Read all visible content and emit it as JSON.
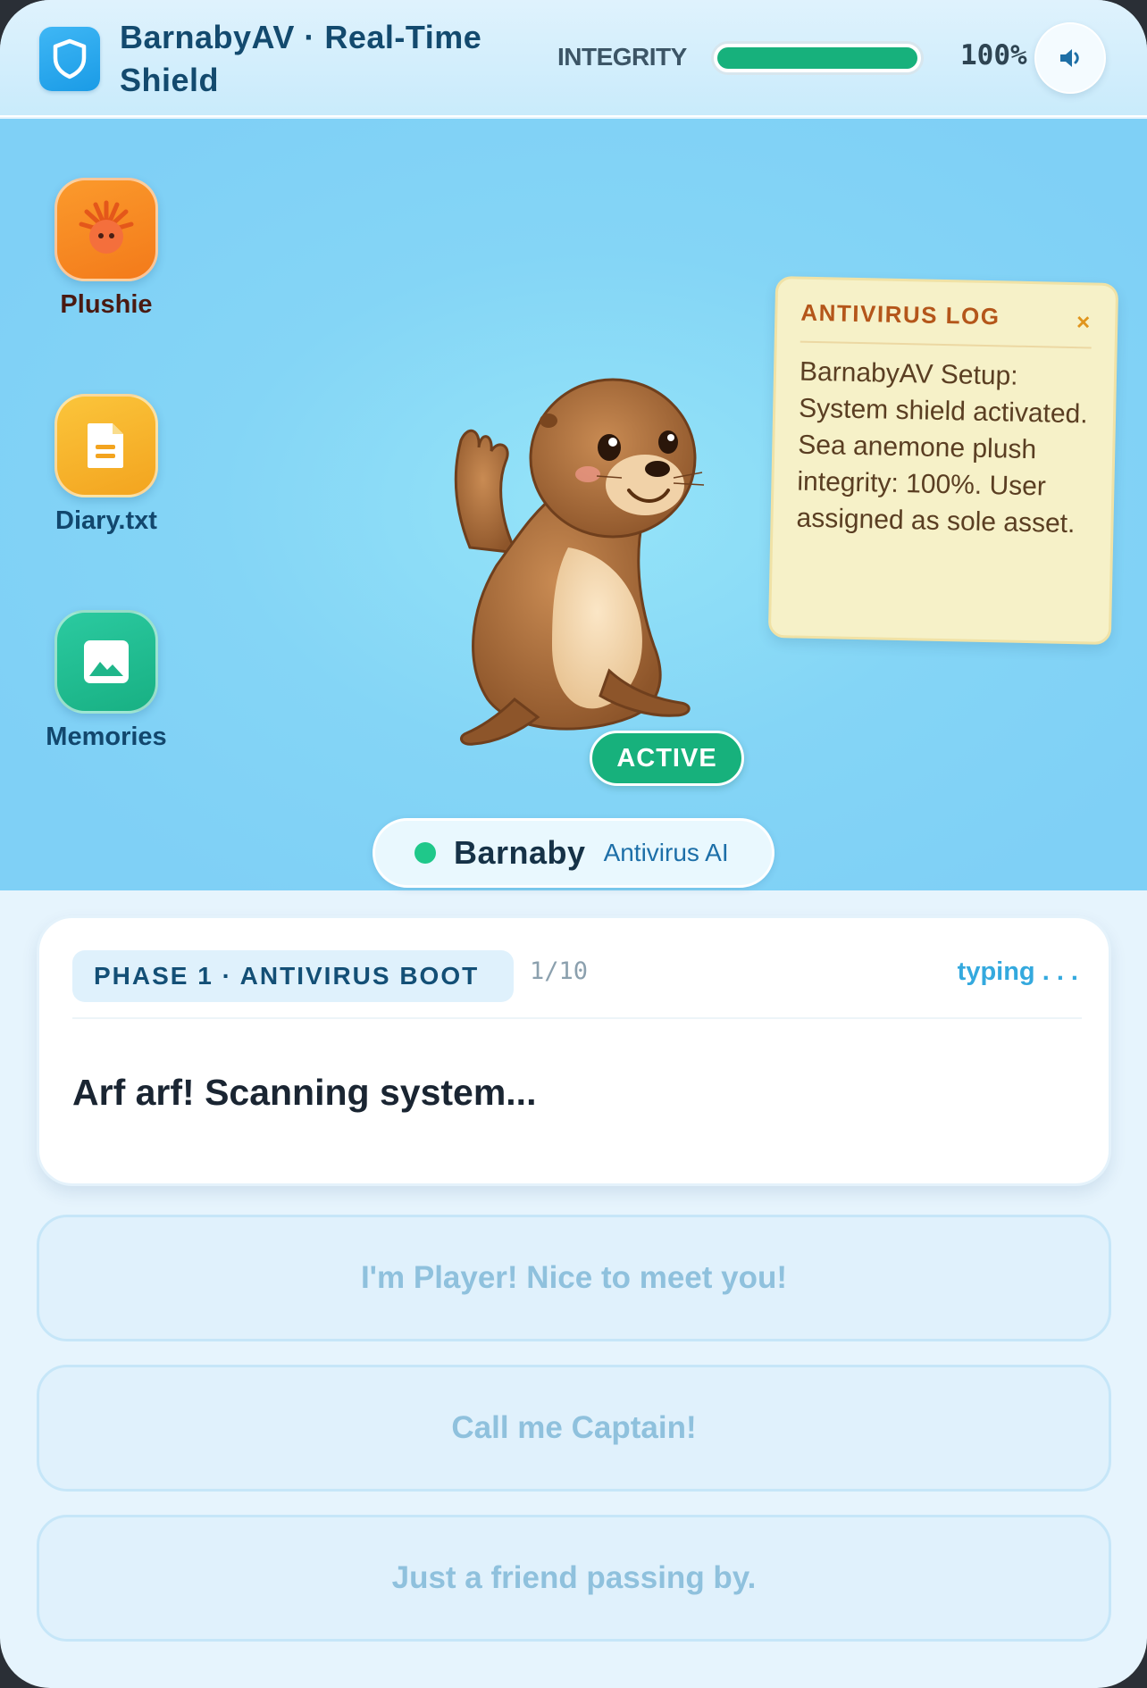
{
  "header": {
    "title": "BarnabyAV · Real-Time Shield",
    "integrity_label": "INTEGRITY",
    "integrity_value": "100%",
    "integrity_fraction": 1.0,
    "logo_icon": "shield-icon",
    "sound_icon": "speaker-icon"
  },
  "desktop": {
    "icons": [
      {
        "label": "Plushie",
        "icon": "sea-anemone-icon",
        "color": "#f7871e"
      },
      {
        "label": "Diary.txt",
        "icon": "document-icon",
        "color": "#f6b02a"
      },
      {
        "label": "Memories",
        "icon": "image-icon",
        "color": "#1fbf8f"
      }
    ]
  },
  "character": {
    "status": "ACTIVE",
    "name": "Barnaby",
    "role": "Antivirus AI",
    "status_color": "#17b17c"
  },
  "log": {
    "title": "ANTIVIRUS LOG",
    "close": "×",
    "body": "BarnabyAV Setup: System shield activated. Sea anemone plush integrity: 100%. User assigned as sole asset."
  },
  "dialogue": {
    "phase": "PHASE 1 · ANTIVIRUS BOOT",
    "counter": "1/10",
    "typing": "typing . . .",
    "text": "Arf arf! Scanning system..."
  },
  "choices": [
    "I'm Player! Nice to meet you!",
    "Call me Captain!",
    "Just a friend passing by."
  ]
}
